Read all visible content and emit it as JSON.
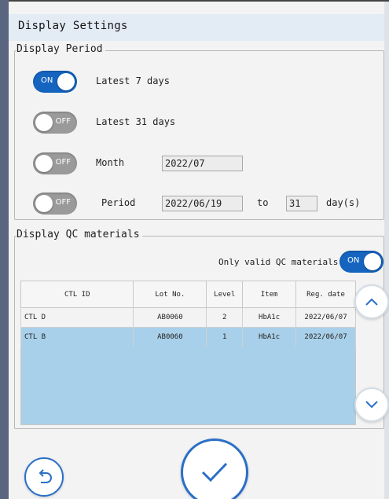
{
  "window": {
    "title": "Display Settings"
  },
  "display_period": {
    "legend": "Display Period",
    "options": [
      {
        "state": "ON",
        "label": "Latest 7 days"
      },
      {
        "state": "OFF",
        "label": "Latest 31 days"
      },
      {
        "state": "OFF",
        "label": "Month",
        "value": "2022/07"
      },
      {
        "state": "OFF",
        "label": "Period",
        "start": "2022/06/19",
        "to_label": "to",
        "days": "31",
        "days_unit": "day(s)"
      }
    ]
  },
  "qc_materials": {
    "legend": "Display QC materials",
    "only_valid_label": "Only valid QC materials",
    "only_valid_state": "ON",
    "columns": [
      "CTL ID",
      "Lot No.",
      "Level",
      "Item",
      "Reg. date"
    ],
    "rows": [
      {
        "ctl_id": "CTL D",
        "lot_no": "AB0060",
        "level": "2",
        "item": "HbA1c",
        "reg_date": "2022/06/07",
        "selected": false
      },
      {
        "ctl_id": "CTL B",
        "lot_no": "AB0060",
        "level": "1",
        "item": "HbA1c",
        "reg_date": "2022/06/07",
        "selected": true
      }
    ]
  },
  "icons": {
    "scroll_up": "chevron-up-icon",
    "scroll_down": "chevron-down-icon",
    "back": "undo-arrow-icon",
    "confirm": "checkmark-icon"
  },
  "colors": {
    "toggle_on": "#1565c0",
    "toggle_off": "#9a9a9a",
    "selected_row": "#a9d0ea",
    "button_accent": "#2a6fc7",
    "title_bar": "#e3ebf5"
  }
}
